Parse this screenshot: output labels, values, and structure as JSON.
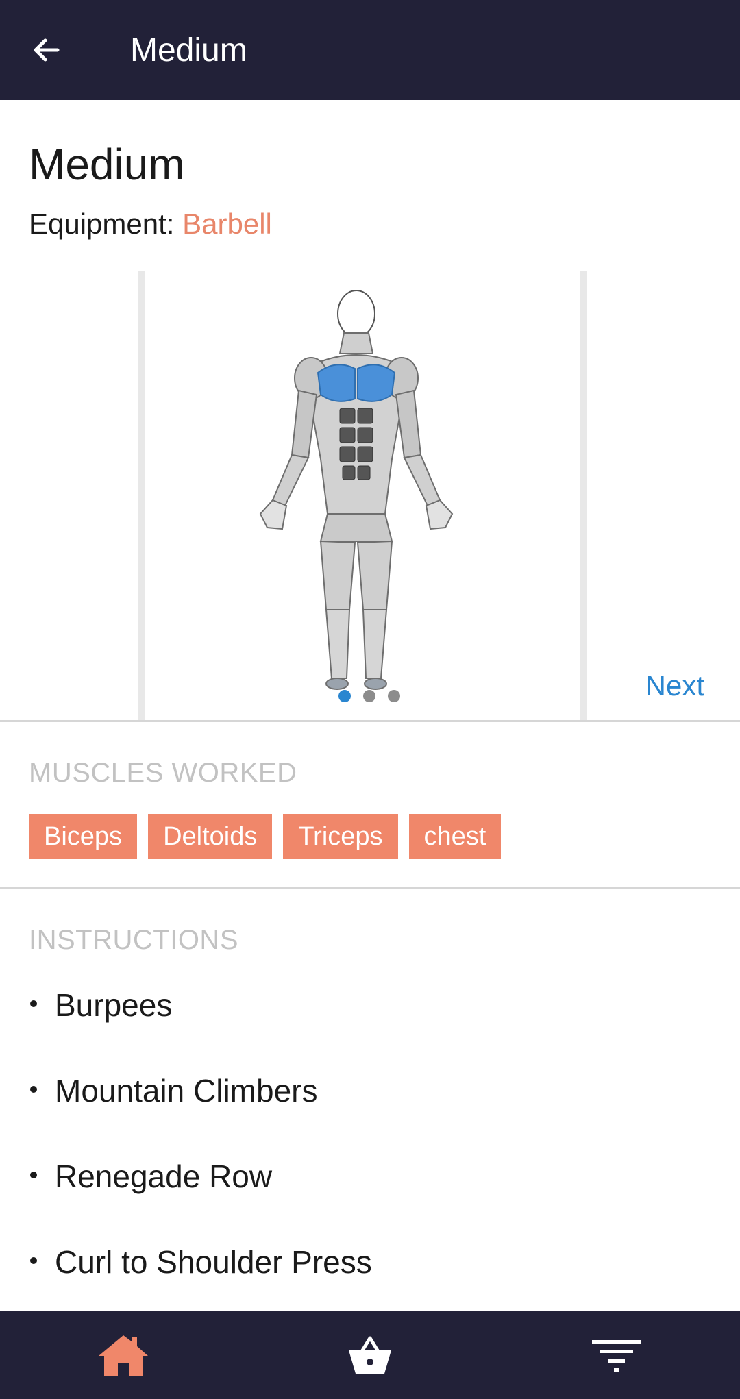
{
  "appbar": {
    "title": "Medium",
    "back_icon": "arrow-back-icon"
  },
  "header": {
    "title": "Medium",
    "equipment_label": "Equipment:",
    "equipment_value": "Barbell"
  },
  "carousel": {
    "image": "front-muscle-chart-chest-highlighted",
    "active_dot": 1,
    "dot_count": 3,
    "next_label": "Next"
  },
  "muscles": {
    "heading": "MUSCLES WORKED",
    "chips": [
      "Biceps",
      "Deltoids",
      "Triceps",
      "chest"
    ]
  },
  "instructions": {
    "heading": "INSTRUCTIONS",
    "items": [
      "Burpees",
      "Mountain Climbers",
      "Renegade Row",
      "Curl to Shoulder Press"
    ]
  },
  "bottom_nav": {
    "items": [
      {
        "icon": "home-icon",
        "active": true
      },
      {
        "icon": "basket-icon",
        "active": false
      },
      {
        "icon": "filter-icon",
        "active": false
      }
    ]
  },
  "colors": {
    "bar": "#222138",
    "accent": "#e8866a",
    "chip": "#f0876a",
    "link": "#2a86d0",
    "muscle_highlight": "#4a90d9"
  }
}
